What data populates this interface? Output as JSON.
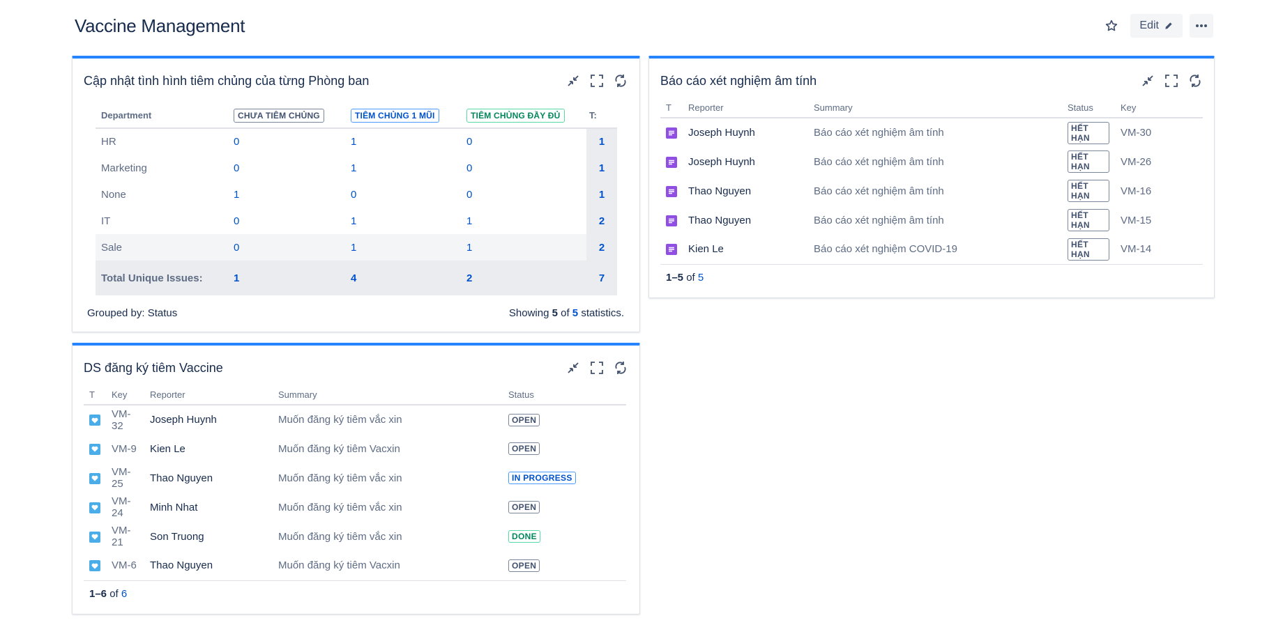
{
  "page": {
    "title": "Vaccine Management",
    "edit_label": "Edit"
  },
  "gadget_stats": {
    "title": "Cập nhật tình hình tiêm chủng của từng Phòng ban",
    "headers": {
      "department": "Department",
      "col1": "CHƯA TIÊM CHỦNG",
      "col2": "TIÊM CHỦNG 1 MŨI",
      "col3": "TIÊM CHỦNG ĐẦY ĐỦ",
      "total": "T:"
    },
    "rows": [
      {
        "dept": "HR",
        "c1": "0",
        "c2": "1",
        "c3": "0",
        "t": "1"
      },
      {
        "dept": "Marketing",
        "c1": "0",
        "c2": "1",
        "c3": "0",
        "t": "1"
      },
      {
        "dept": "None",
        "c1": "1",
        "c2": "0",
        "c3": "0",
        "t": "1"
      },
      {
        "dept": "IT",
        "c1": "0",
        "c2": "1",
        "c3": "1",
        "t": "2"
      },
      {
        "dept": "Sale",
        "c1": "0",
        "c2": "1",
        "c3": "1",
        "t": "2"
      }
    ],
    "total": {
      "label": "Total Unique Issues:",
      "c1": "1",
      "c2": "4",
      "c3": "2",
      "t": "7"
    },
    "grouped_by": "Grouped by: Status",
    "showing_prefix": "Showing",
    "showing_count": "5",
    "showing_of": "of",
    "showing_total": "5",
    "showing_suffix": "statistics."
  },
  "gadget_tests": {
    "title": "Báo cáo xét nghiệm âm tính",
    "headers": {
      "t": "T",
      "reporter": "Reporter",
      "summary": "Summary",
      "status": "Status",
      "key": "Key"
    },
    "rows": [
      {
        "reporter": "Joseph Huynh",
        "summary": "Báo cáo xét nghiệm âm tính",
        "status": "HẾT HẠN",
        "key": "VM-30"
      },
      {
        "reporter": "Joseph Huynh",
        "summary": "Báo cáo xét nghiệm âm tính",
        "status": "HẾT HẠN",
        "key": "VM-26"
      },
      {
        "reporter": "Thao Nguyen",
        "summary": "Báo cáo xét nghiệm âm tính",
        "status": "HẾT HẠN",
        "key": "VM-16"
      },
      {
        "reporter": "Thao Nguyen",
        "summary": "Báo cáo xét nghiệm âm tính",
        "status": "HẾT HẠN",
        "key": "VM-15"
      },
      {
        "reporter": "Kien Le",
        "summary": "Báo cáo xét nghiệm COVID-19",
        "status": "HẾT HẠN",
        "key": "VM-14"
      }
    ],
    "pager": {
      "range": "1–5",
      "of": "of",
      "total": "5"
    }
  },
  "gadget_reg": {
    "title": "DS đăng ký tiêm Vaccine",
    "headers": {
      "t": "T",
      "key": "Key",
      "reporter": "Reporter",
      "summary": "Summary",
      "status": "Status"
    },
    "rows": [
      {
        "key": "VM-32",
        "reporter": "Joseph Huynh",
        "summary": "Muốn đăng ký tiêm vắc xin",
        "status": "OPEN",
        "tone": "gray"
      },
      {
        "key": "VM-9",
        "reporter": "Kien Le",
        "summary": "Muốn đăng ký tiêm Vacxin",
        "status": "OPEN",
        "tone": "gray"
      },
      {
        "key": "VM-25",
        "reporter": "Thao Nguyen",
        "summary": "Muốn đăng ký tiêm vắc xin",
        "status": "IN PROGRESS",
        "tone": "blue"
      },
      {
        "key": "VM-24",
        "reporter": "Minh Nhat",
        "summary": "Muốn đăng ký tiêm vắc xin",
        "status": "OPEN",
        "tone": "gray"
      },
      {
        "key": "VM-21",
        "reporter": "Son Truong",
        "summary": "Muốn đăng ký tiêm vắc xin",
        "status": "DONE",
        "tone": "green"
      },
      {
        "key": "VM-6",
        "reporter": "Thao Nguyen",
        "summary": "Muốn đăng ký tiêm Vacxin",
        "status": "OPEN",
        "tone": "gray"
      }
    ],
    "pager": {
      "range": "1–6",
      "of": "of",
      "total": "6"
    }
  },
  "icons": {
    "star": "star-icon",
    "edit": "pencil-icon",
    "more": "more-icon",
    "minimize": "minimize-icon",
    "fullscreen": "fullscreen-icon",
    "refresh": "refresh-icon",
    "test_type": "task-icon",
    "reg_type": "story-icon"
  },
  "colors": {
    "accent": "#2684ff",
    "link": "#0052cc",
    "done": "#00875a",
    "task_icon": "#904ee2",
    "story_icon": "#4bade8"
  }
}
